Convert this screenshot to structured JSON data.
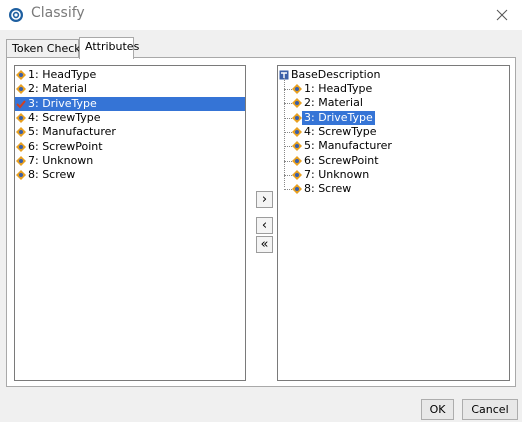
{
  "window": {
    "title": "Classify"
  },
  "tabs": [
    {
      "label": "Token Checks",
      "selected": false
    },
    {
      "label": "Attributes",
      "selected": true
    }
  ],
  "available_attributes": [
    {
      "label": "1: HeadType",
      "icon": "attribute-icon"
    },
    {
      "label": "2: Material",
      "icon": "attribute-icon"
    },
    {
      "label": "3: DriveType",
      "icon": "checkmark-icon",
      "selected": true
    },
    {
      "label": "4: ScrewType",
      "icon": "attribute-icon"
    },
    {
      "label": "5: Manufacturer",
      "icon": "attribute-icon"
    },
    {
      "label": "6: ScrewPoint",
      "icon": "attribute-icon"
    },
    {
      "label": "7: Unknown",
      "icon": "attribute-icon"
    },
    {
      "label": "8: Screw",
      "icon": "attribute-icon"
    }
  ],
  "selected_tree": {
    "root": {
      "label": "BaseDescription",
      "icon": "tree-root-icon"
    },
    "children": [
      {
        "label": "1: HeadType"
      },
      {
        "label": "2: Material"
      },
      {
        "label": "3: DriveType",
        "selected": true
      },
      {
        "label": "4: ScrewType"
      },
      {
        "label": "5: Manufacturer"
      },
      {
        "label": "6: ScrewPoint"
      },
      {
        "label": "7: Unknown"
      },
      {
        "label": "8: Screw"
      }
    ]
  },
  "move_buttons": {
    "add": "›",
    "remove": "‹",
    "remove_all": "«"
  },
  "buttons": {
    "ok": "OK",
    "cancel": "Cancel"
  },
  "colors": {
    "selection": "#3574d6",
    "attribute_icon_orange": "#e8a020",
    "attribute_icon_blue": "#3a5fa8",
    "checkmark_red": "#d04020",
    "app_icon_blue": "#1e5fa0"
  }
}
